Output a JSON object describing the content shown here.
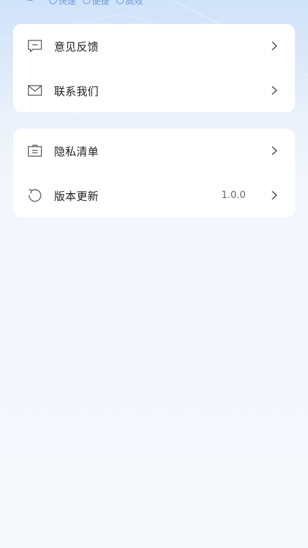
{
  "header": {
    "tags": [
      "快速",
      "便捷",
      "高效"
    ]
  },
  "menu_group_1": {
    "items": [
      {
        "label": "意见反馈",
        "icon": "feedback-icon"
      },
      {
        "label": "联系我们",
        "icon": "mail-icon"
      }
    ]
  },
  "menu_group_2": {
    "items": [
      {
        "label": "隐私清单",
        "icon": "privacy-list-icon"
      },
      {
        "label": "版本更新",
        "icon": "refresh-icon",
        "value": "1.0.0"
      }
    ]
  },
  "colors": {
    "accent": "#6f9bd7",
    "text": "#1f1f1f",
    "secondary_text": "#666666"
  }
}
